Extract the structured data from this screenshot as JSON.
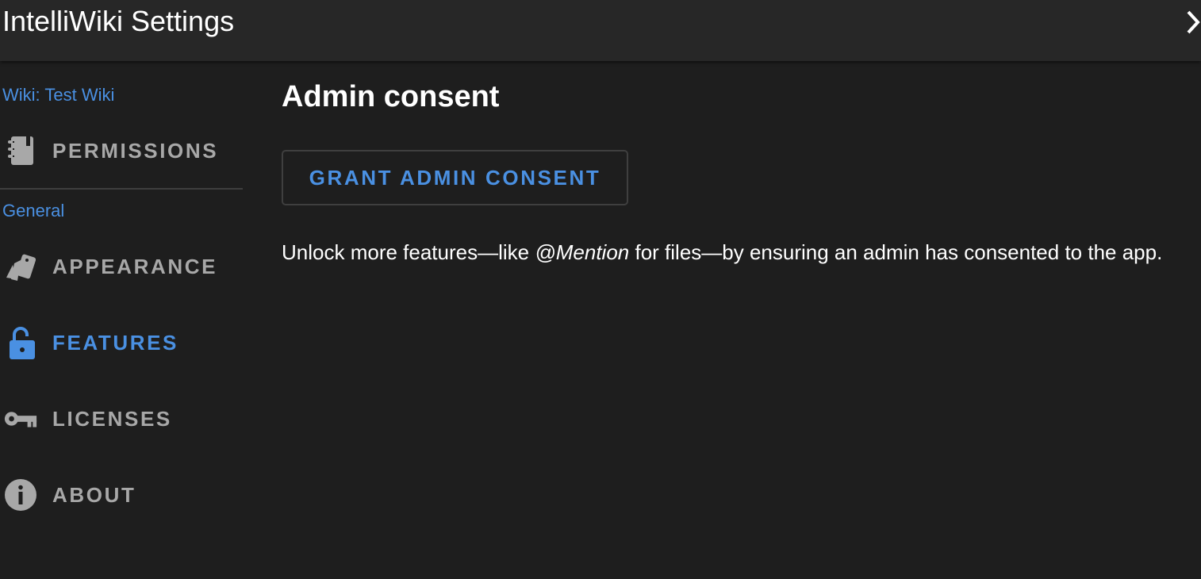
{
  "window": {
    "title": "IntelliWiki Settings"
  },
  "sidebar": {
    "wiki_label": "Wiki: Test Wiki",
    "general_label": "General",
    "items": [
      {
        "label": "PERMISSIONS",
        "icon": "notebook-icon",
        "active": false
      },
      {
        "label": "APPEARANCE",
        "icon": "cards-icon",
        "active": false
      },
      {
        "label": "FEATURES",
        "icon": "unlocked-lock-icon",
        "active": true
      },
      {
        "label": "LICENSES",
        "icon": "key-icon",
        "active": false
      },
      {
        "label": "ABOUT",
        "icon": "info-icon",
        "active": false
      }
    ]
  },
  "main": {
    "heading": "Admin consent",
    "button_label": "GRANT ADMIN CONSENT",
    "description_before": "Unlock more features—like ",
    "description_emphasis": "@Mention",
    "description_after": " for files—by ensuring an admin has consented to the app."
  },
  "colors": {
    "accent": "#4a90e2",
    "background": "#1e1e1e",
    "titlebar": "#272727",
    "muted_text": "#a8a8a8"
  }
}
